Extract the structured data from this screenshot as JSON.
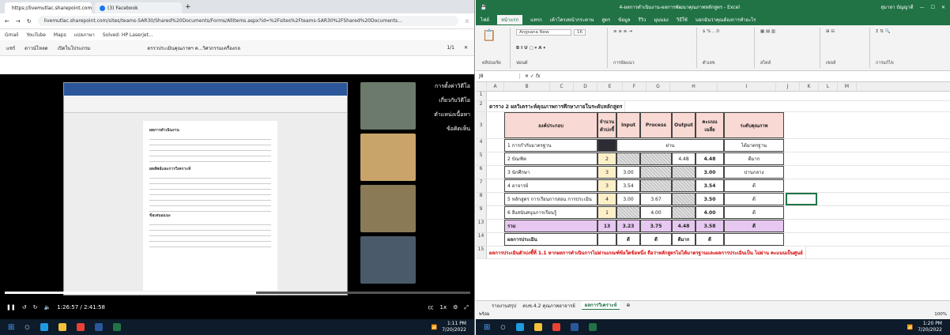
{
  "left": {
    "tabs": [
      {
        "label": "https://livemutlac.sharepoint.com"
      },
      {
        "label": "(3) Facebook"
      }
    ],
    "url": "livemutlac.sharepoint.com/sites/teams-SAR30/Shared%20Documents/Forms/AllItems.aspx?id=%2Fsites%2Fteams-SAR30%2FShared%20Documents...",
    "bookmarks": [
      "Gmail",
      "YouTube",
      "Maps",
      "แปลภาษา",
      "Solved: HP Laserjet..."
    ],
    "doc_toolbar": {
      "share": "แชร์",
      "download": "ดาวน์โหลด",
      "open": "เปิดในโปรแกรม",
      "title": "ดรรวประเมินคุณภาพฯ ค...วิศวกรรมเครื่องกล",
      "page": "1/1"
    },
    "side_menu": [
      "การตั้งค่าวิดีโอ",
      "เกี่ยวกับวิดีโอ",
      "ตำแหน่งเนื้อหา",
      "ข้อคิดเห็น"
    ],
    "video": {
      "time": "1:26:57 / 2:41:58",
      "progress": 0.54,
      "speed": "1x",
      "doc_lines": [
        "ผลการดำเนินงาน",
        "ผลลัพธ์และการวิเคราะห์",
        "ข้อเสนอแนะ"
      ]
    },
    "clock": {
      "time": "1:11 PM",
      "date": "7/20/2022"
    }
  },
  "right": {
    "title": "4-ผลการดำเนินงาน-ผลการพัฒนาคุณภาพหลักสูตร - Excel",
    "user": "สุมาลา บัญญาดี",
    "ribbon_tabs": [
      "ไฟล์",
      "หน้าแรก",
      "แทรก",
      "เค้าโครงหน้ากระดาษ",
      "สูตร",
      "ข้อมูล",
      "รีวิว",
      "มุมมอง",
      "วิธีใช้",
      "บอกฉันว่าคุณต้องการทำอะไร"
    ],
    "ribbon_selected": 1,
    "ribbon_groups": [
      "คลิปบอร์ด",
      "ฟอนต์",
      "การจัดแนว",
      "ตัวเลข",
      "สไตล์",
      "เซลล์",
      "การแก้ไข"
    ],
    "font": "Angsana New",
    "font_size": "16",
    "name_box": "J8",
    "columns": [
      "A",
      "B",
      "C",
      "D",
      "E",
      "F",
      "G",
      "H",
      "I",
      "J",
      "K",
      "L",
      "M",
      "N"
    ],
    "table_title": "ตาราง 2 ผลวิเคราะห์คุณภาพการศึกษาภายในระดับหลักสูตร",
    "headers": [
      "องค์ประกอบ",
      "จำนวนตัวบ่งชี้",
      "Input",
      "Process",
      "Output",
      "คะแนนเฉลี่ย",
      "ระดับคุณภาพ"
    ],
    "rows": [
      {
        "rn": "4",
        "name": "1 การกำกับมาตรฐาน",
        "count": "",
        "input": "",
        "process": "ผ่าน",
        "output": "",
        "avg": "",
        "level": "ได้มาตรฐาน",
        "kind": "pass"
      },
      {
        "rn": "5",
        "name": "2 บัณฑิต",
        "count": "2",
        "input": "",
        "process": "",
        "output": "4.48",
        "avg": "4.48",
        "level": "ดีมาก"
      },
      {
        "rn": "6",
        "name": "3 นักศึกษา",
        "count": "3",
        "input": "3.00",
        "process": "",
        "output": "",
        "avg": "3.00",
        "level": "ปานกลาง"
      },
      {
        "rn": "7",
        "name": "4 อาจารย์",
        "count": "3",
        "input": "3.54",
        "process": "",
        "output": "",
        "avg": "3.54",
        "level": "ดี"
      },
      {
        "rn": "8",
        "name": "5 หลักสูตร การเรียนการสอน การประเมิน",
        "count": "4",
        "input": "3.00",
        "process": "3.67",
        "output": "",
        "avg": "3.50",
        "level": "ดี"
      },
      {
        "rn": "9",
        "name": "6 สิ่งสนับสนุนการเรียนรู้",
        "count": "1",
        "input": "",
        "process": "4.00",
        "output": "",
        "avg": "4.00",
        "level": "ดี"
      }
    ],
    "total": {
      "rn": "13",
      "name": "รวม",
      "count": "13",
      "input": "3.23",
      "process": "3.75",
      "output": "4.48",
      "avg": "3.58",
      "level": "ดี"
    },
    "result": {
      "rn": "14",
      "name": "ผลการประเมิน",
      "input": "ดี",
      "process": "ดี",
      "output": "ดีมาก",
      "avg": "ดี"
    },
    "note": "ผลการประเมินตัวบ่งชี้ที่ 1.1 หากผลการดำเนินการไม่ผ่านเกณฑ์ข้อใดข้อหนึ่ง ถือว่าหลักสูตรไม่ได้มาตรฐานและผลการประเมินเป็น ไม่ผ่าน คะแนนเป็นศูนย์",
    "note_rn": "15",
    "sheet_tabs": [
      "รายงานสรุป",
      "ตบช.4.2 คุณภาพอาจารย์",
      "ผลการวิเคราะห์"
    ],
    "sheet_selected": 2,
    "status_ready": "พร้อม",
    "zoom": "100%",
    "clock": {
      "time": "1:20 PM",
      "date": "7/20/2022"
    }
  }
}
